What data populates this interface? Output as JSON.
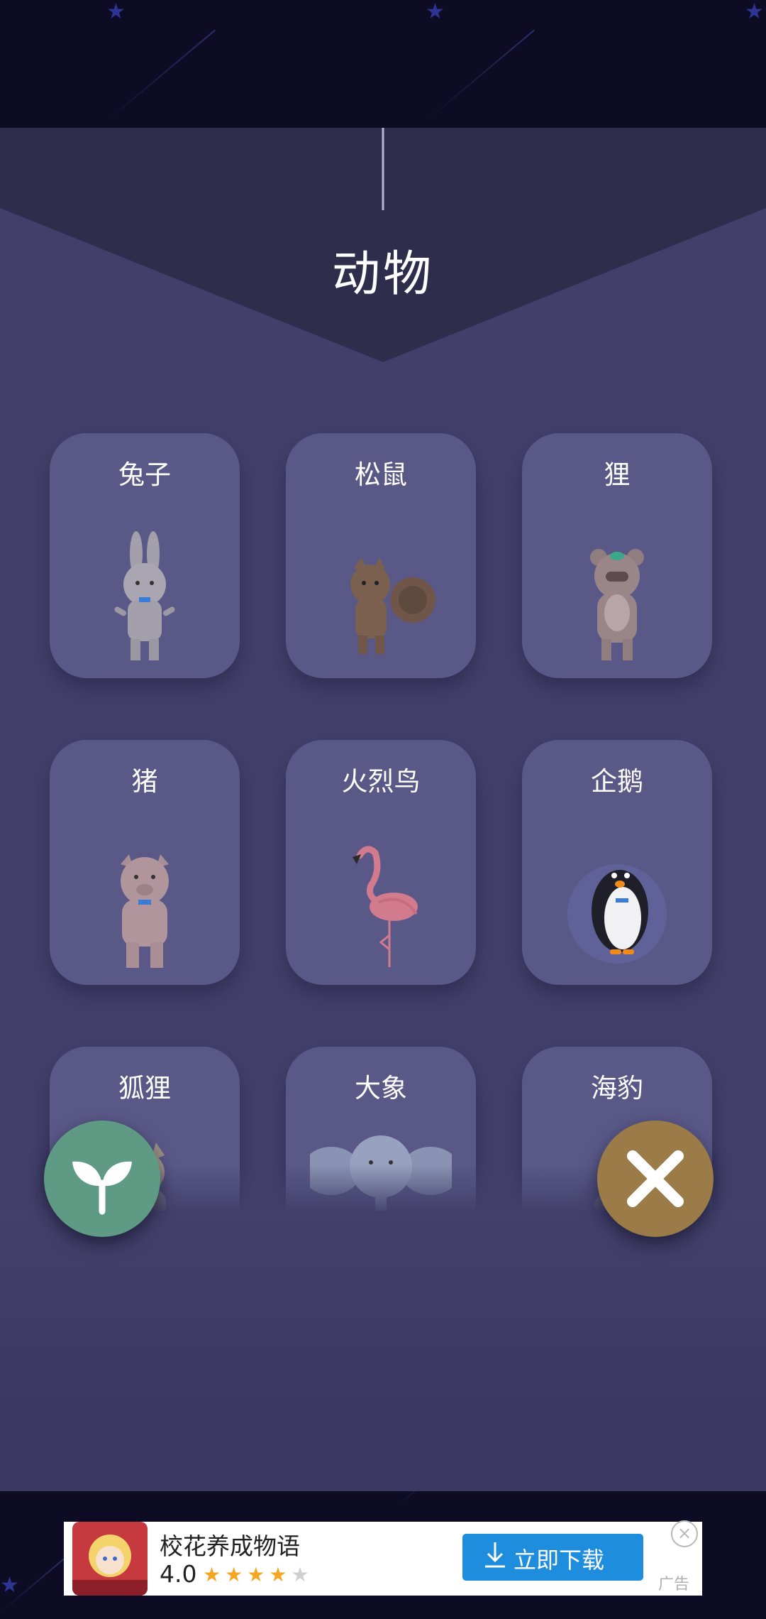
{
  "screen": {
    "title": "动物"
  },
  "animals": [
    {
      "label": "兔子",
      "icon": "rabbit-icon"
    },
    {
      "label": "松鼠",
      "icon": "squirrel-icon"
    },
    {
      "label": "狸",
      "icon": "raccoon-dog-icon"
    },
    {
      "label": "猪",
      "icon": "pig-icon"
    },
    {
      "label": "火烈鸟",
      "icon": "flamingo-icon"
    },
    {
      "label": "企鹅",
      "icon": "penguin-icon"
    },
    {
      "label": "狐狸",
      "icon": "fox-icon"
    },
    {
      "label": "大象",
      "icon": "elephant-icon"
    },
    {
      "label": "海豹",
      "icon": "seal-icon"
    }
  ],
  "actions": {
    "left": "sprout-icon",
    "right": "close-icon"
  },
  "ad": {
    "title": "校花养成物语",
    "rating": "4.0",
    "stars_filled": 4,
    "stars_total": 5,
    "download_label": "立即下载",
    "badge": "广告"
  },
  "colors": {
    "background": "#0d0c24",
    "panel": "#42406a",
    "card": "#5a5887",
    "sprout_button": "#5f9b84",
    "close_button": "#9b7b48",
    "download_button": "#1f8ddd"
  }
}
